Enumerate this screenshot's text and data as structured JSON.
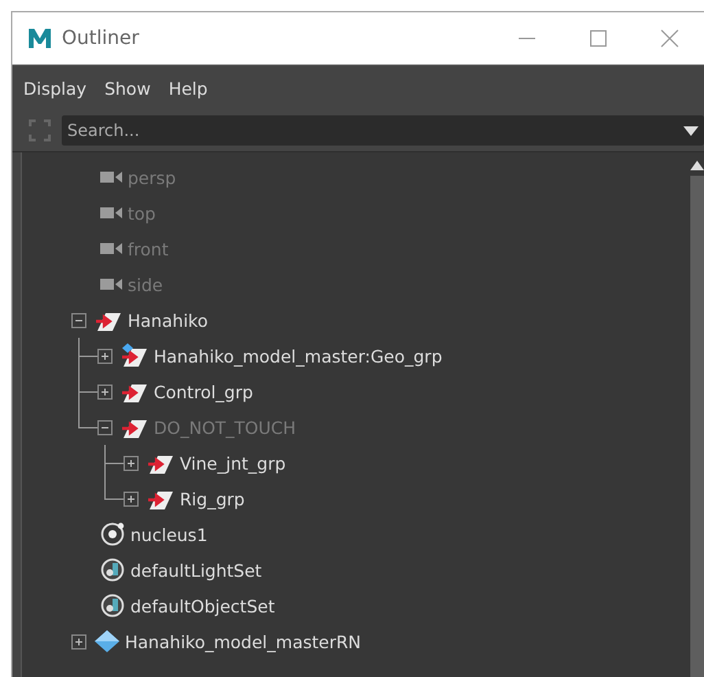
{
  "window": {
    "title": "Outliner"
  },
  "menu": [
    "Display",
    "Show",
    "Help"
  ],
  "search": {
    "placeholder": "Search..."
  },
  "tree": [
    {
      "label": "persp",
      "kind": "camera",
      "dimmed": true
    },
    {
      "label": "top",
      "kind": "camera",
      "dimmed": true
    },
    {
      "label": "front",
      "kind": "camera",
      "dimmed": true
    },
    {
      "label": "side",
      "kind": "camera",
      "dimmed": true
    },
    {
      "label": "Hanahiko",
      "kind": "transform",
      "dimmed": false,
      "expanded": true,
      "children": [
        {
          "label": "Hanahiko_model_master:Geo_grp",
          "kind": "referenced-transform",
          "dimmed": false,
          "expanded": false
        },
        {
          "label": "Control_grp",
          "kind": "transform",
          "dimmed": false,
          "expanded": false
        },
        {
          "label": "DO_NOT_TOUCH",
          "kind": "transform",
          "dimmed": true,
          "expanded": true,
          "children": [
            {
              "label": "Vine_jnt_grp",
              "kind": "transform",
              "dimmed": false,
              "expanded": false
            },
            {
              "label": "Rig_grp",
              "kind": "transform",
              "dimmed": false,
              "expanded": false
            }
          ]
        }
      ]
    },
    {
      "label": "nucleus1",
      "kind": "nucleus",
      "dimmed": false
    },
    {
      "label": "defaultLightSet",
      "kind": "set",
      "dimmed": false
    },
    {
      "label": "defaultObjectSet",
      "kind": "set",
      "dimmed": false
    },
    {
      "label": "Hanahiko_model_masterRN",
      "kind": "reference",
      "dimmed": false,
      "expanded": false
    }
  ]
}
